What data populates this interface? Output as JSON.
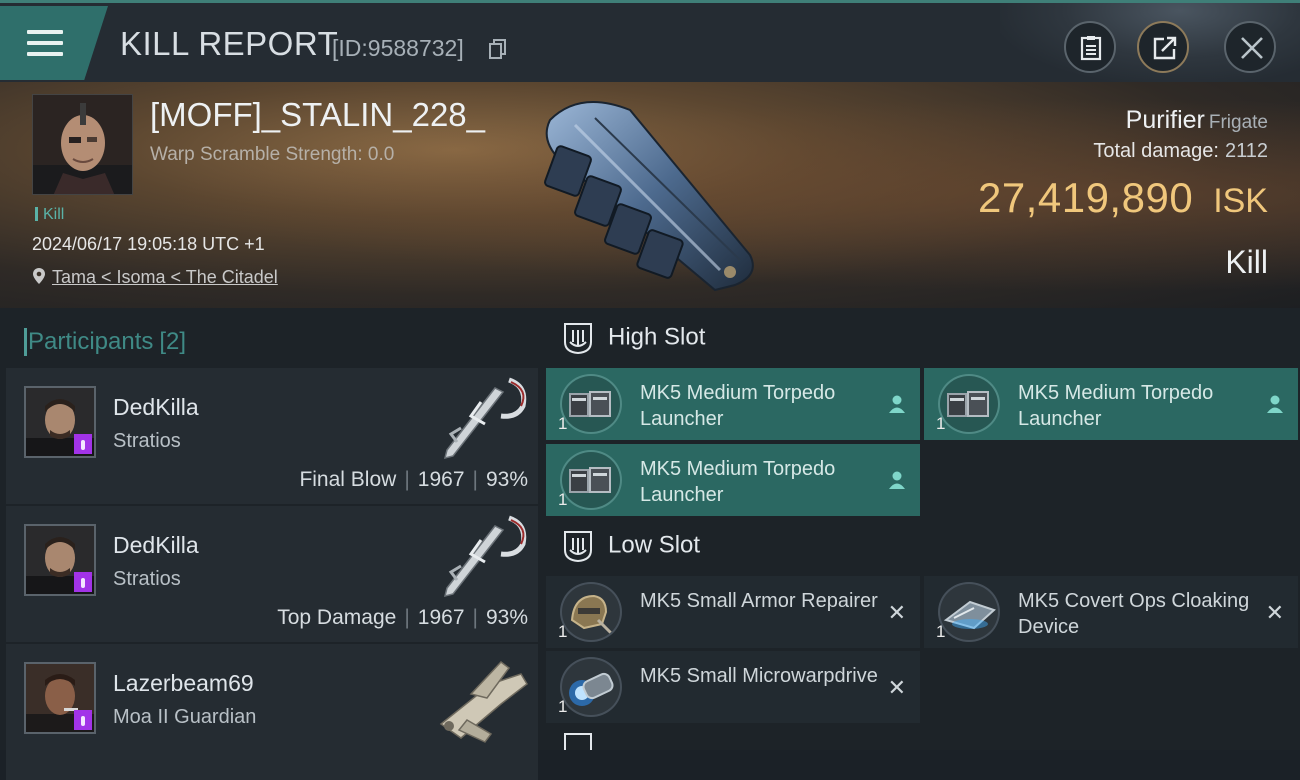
{
  "header": {
    "title": "KILL REPORT",
    "report_id": "[ID:9588732]"
  },
  "victim": {
    "name": "[MOFF]_STALIN_228_",
    "warp_scramble": "Warp Scramble Strength: 0.0",
    "kill_tag": "Kill",
    "datetime": "2024/06/17 19:05:18 UTC +1",
    "location": "Tama < Isoma < The Citadel",
    "ship_name": "Purifier",
    "ship_category": "Frigate",
    "total_damage_label": "Total damage:",
    "total_damage": "2112",
    "isk_value": "27,419,890",
    "isk_unit": "ISK",
    "result": "Kill"
  },
  "participants": {
    "title": "Participants",
    "count": "[2]",
    "rows": [
      {
        "name": "DedKilla",
        "ship": "Stratios",
        "role": "Final Blow",
        "damage": "1967",
        "percent": "93%"
      },
      {
        "name": "DedKilla",
        "ship": "Stratios",
        "role": "Top Damage",
        "damage": "1967",
        "percent": "93%"
      },
      {
        "name": "Lazerbeam69",
        "ship": "Moa II Guardian"
      }
    ],
    "separator": "|"
  },
  "fitting": {
    "high_slot": {
      "label": "High Slot",
      "modules": [
        {
          "name": "MK5 Medium Torpedo Launcher",
          "qty": "1",
          "status": "pilot"
        },
        {
          "name": "MK5 Medium Torpedo Launcher",
          "qty": "1",
          "status": "pilot"
        },
        {
          "name": "MK5 Medium Torpedo Launcher",
          "qty": "1",
          "status": "pilot"
        }
      ]
    },
    "low_slot": {
      "label": "Low Slot",
      "modules": [
        {
          "name": "MK5 Small Armor Repairer",
          "qty": "1",
          "status": "destroyed"
        },
        {
          "name": "MK5 Covert Ops Cloaking Device",
          "qty": "1",
          "status": "destroyed"
        },
        {
          "name": "MK5 Small Microwarpdrive",
          "qty": "1",
          "status": "destroyed"
        }
      ]
    },
    "destroyed_mark": "✕"
  },
  "colors": {
    "accent_teal": "#2b6862",
    "isk_gold": "#f0c77c",
    "badge_purple": "#a233e8"
  },
  "icons": [
    "menu-icon",
    "copy-icon",
    "clipboard-icon",
    "share-icon",
    "close-icon",
    "location-pin-icon",
    "pilot-icon",
    "slot-icon"
  ]
}
